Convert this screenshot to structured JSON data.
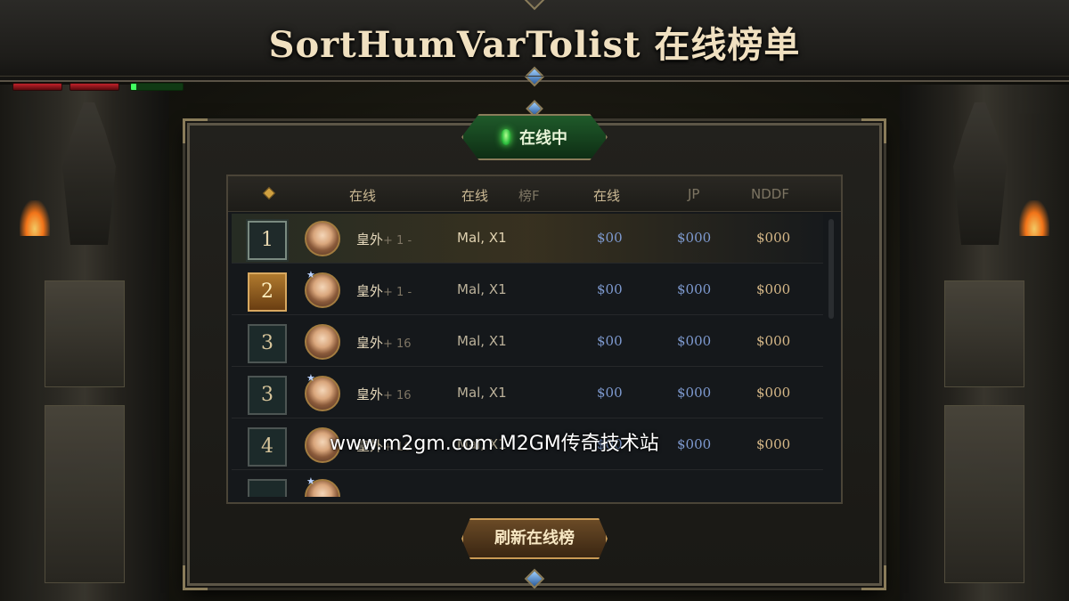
{
  "title": "SortHumVarTolist 在线榜单",
  "status_badge": "在线中",
  "headers": [
    "在线",
    "在线",
    "榜F",
    "在线",
    "JP",
    "NDDF"
  ],
  "rows": [
    {
      "rank": "1",
      "name": "皇外",
      "sub": "+ 1 -",
      "cls": "Mal, X1",
      "v1": "$00",
      "v2": "$000",
      "v3": "$000"
    },
    {
      "rank": "2",
      "name": "皇外",
      "sub": "+ 1 -",
      "cls": "Mal, X1",
      "v1": "$00",
      "v2": "$000",
      "v3": "$000"
    },
    {
      "rank": "3",
      "name": "皇外",
      "sub": "+ 16",
      "cls": "Mal, X1",
      "v1": "$00",
      "v2": "$000",
      "v3": "$000"
    },
    {
      "rank": "3",
      "name": "皇外",
      "sub": "+ 16",
      "cls": "Mal, X1",
      "v1": "$00",
      "v2": "$000",
      "v3": "$000"
    },
    {
      "rank": "4",
      "name": "皇外",
      "sub": "+ 16",
      "cls": "Mal, X1",
      "v1": "$00",
      "v2": "$000",
      "v3": "$000"
    }
  ],
  "watermark": "www.m2gm.com M2GM传奇技术站",
  "refresh_button": "刷新在线榜"
}
